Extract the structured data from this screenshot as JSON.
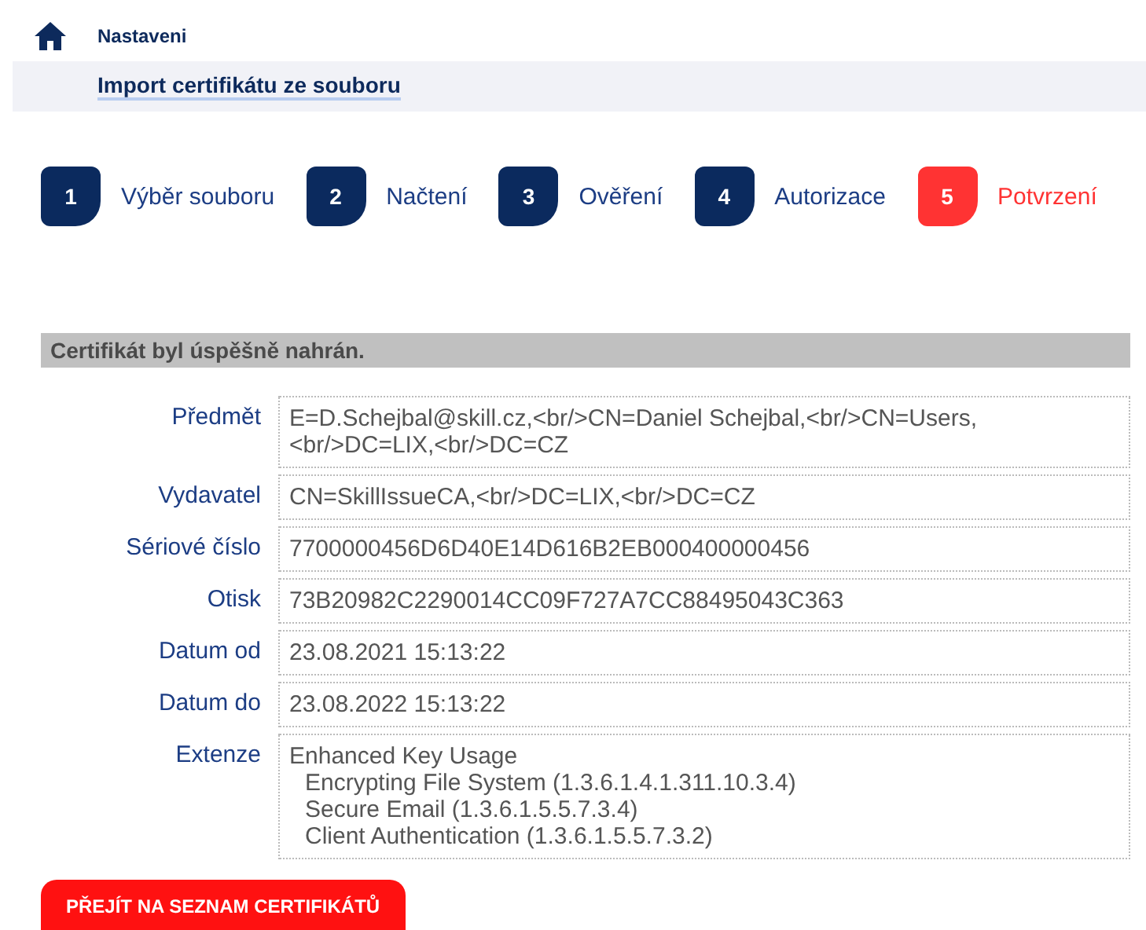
{
  "breadcrumb": {
    "parent": "Nastaveni",
    "title": "Import certifikátu ze souboru"
  },
  "steps": [
    {
      "number": "1",
      "label": "Výběr souboru",
      "selected": false
    },
    {
      "number": "2",
      "label": "Načtení",
      "selected": false
    },
    {
      "number": "3",
      "label": "Ověření",
      "selected": false
    },
    {
      "number": "4",
      "label": "Autorizace",
      "selected": false
    },
    {
      "number": "5",
      "label": "Potvrzení",
      "selected": true
    }
  ],
  "message": "Certifikát byl úspěšně nahrán.",
  "details": [
    {
      "kind": "text",
      "label": "Předmět",
      "value": "E=D.Schejbal@skill.cz,<br/>CN=Daniel Schejbal,<br/>CN=Users,<br/>DC=LIX,<br/>DC=CZ"
    },
    {
      "kind": "text",
      "label": "Vydavatel",
      "value": "CN=SkillIssueCA,<br/>DC=LIX,<br/>DC=CZ"
    },
    {
      "kind": "text",
      "label": "Sériové číslo",
      "value": "7700000456D6D40E14D616B2EB000400000456"
    },
    {
      "kind": "text",
      "label": "Otisk",
      "value": "73B20982C2290014CC09F727A7CC88495043C363"
    },
    {
      "kind": "text",
      "label": "Datum od",
      "value": "23.08.2021 15:13:22"
    },
    {
      "kind": "text",
      "label": "Datum do",
      "value": "23.08.2022 15:13:22"
    },
    {
      "kind": "tree",
      "label": "Extenze",
      "value": "Enhanced Key Usage",
      "children": [
        "Encrypting File System (1.3.6.1.4.1.311.10.3.4)",
        "Secure Email (1.3.6.1.5.5.7.3.4)",
        "Client Authentication (1.3.6.1.5.5.7.3.2)"
      ]
    }
  ],
  "button": "PŘEJÍT NA SEZNAM CERTIFIKÁTŮ"
}
